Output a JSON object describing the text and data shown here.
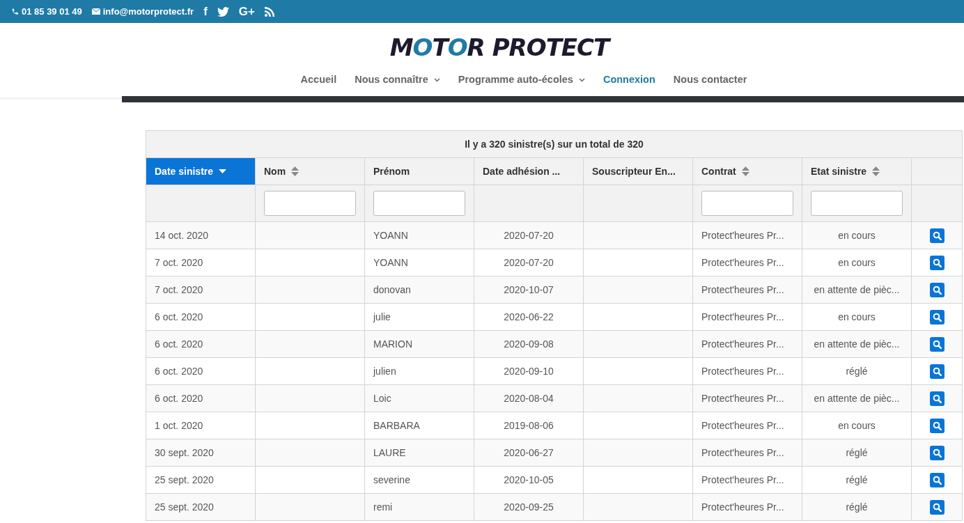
{
  "topbar": {
    "phone": "01 85 39 01 49",
    "email": "info@motorprotect.fr",
    "social": [
      "f",
      "G+"
    ]
  },
  "logo": {
    "text": "MOTOR PROTECT"
  },
  "nav": [
    {
      "label": "Accueil",
      "selected": false,
      "dropdown": false
    },
    {
      "label": "Nous connaître",
      "selected": false,
      "dropdown": true
    },
    {
      "label": "Programme auto-écoles",
      "selected": false,
      "dropdown": true
    },
    {
      "label": "Connexion",
      "selected": true,
      "dropdown": false
    },
    {
      "label": "Nous contacter",
      "selected": false,
      "dropdown": false
    }
  ],
  "table": {
    "caption": "Il y a 320 sinistre(s) sur un total de 320",
    "columns": [
      {
        "label": "Date sinistre",
        "sortable": true,
        "selected": true,
        "filter": false
      },
      {
        "label": "Nom",
        "sortable": true,
        "selected": false,
        "filter": true
      },
      {
        "label": "Prénom",
        "sortable": false,
        "selected": false,
        "filter": true
      },
      {
        "label": "Date adhésion ...",
        "sortable": false,
        "selected": false,
        "filter": false
      },
      {
        "label": "Souscripteur En...",
        "sortable": false,
        "selected": false,
        "filter": false
      },
      {
        "label": "Contrat",
        "sortable": true,
        "selected": false,
        "filter": true
      },
      {
        "label": "Etat sinistre",
        "sortable": true,
        "selected": false,
        "filter": true
      }
    ],
    "rows": [
      [
        "14 oct. 2020",
        "",
        "YOANN",
        "2020-07-20",
        "",
        "Protect'heures Pr...",
        "en cours"
      ],
      [
        "7 oct. 2020",
        "",
        "YOANN",
        "2020-07-20",
        "",
        "Protect'heures Pr...",
        "en cours"
      ],
      [
        "7 oct. 2020",
        "",
        "donovan",
        "2020-10-07",
        "",
        "Protect'heures Pr...",
        "en attente de pièc..."
      ],
      [
        "6 oct. 2020",
        "",
        "julie",
        "2020-06-22",
        "",
        "Protect'heures Pr...",
        "en cours"
      ],
      [
        "6 oct. 2020",
        "",
        "MARION",
        "2020-09-08",
        "",
        "Protect'heures Pr...",
        "en attente de pièc..."
      ],
      [
        "6 oct. 2020",
        "",
        "julien",
        "2020-09-10",
        "",
        "Protect'heures Pr...",
        "réglé"
      ],
      [
        "6 oct. 2020",
        "",
        "Loic",
        "2020-08-04",
        "",
        "Protect'heures Pr...",
        "en attente de pièc..."
      ],
      [
        "1 oct. 2020",
        "",
        "BARBARA",
        "2019-08-06",
        "",
        "Protect'heures Pr...",
        "en cours"
      ],
      [
        "30 sept. 2020",
        "",
        "LAURE",
        "2020-06-27",
        "",
        "Protect'heures Pr...",
        "réglé"
      ],
      [
        "25 sept. 2020",
        "",
        "severine",
        "2020-10-05",
        "",
        "Protect'heures Pr...",
        "réglé"
      ],
      [
        "25 sept. 2020",
        "",
        "remi",
        "2020-09-25",
        "",
        "Protect'heures Pr...",
        "réglé"
      ]
    ]
  }
}
